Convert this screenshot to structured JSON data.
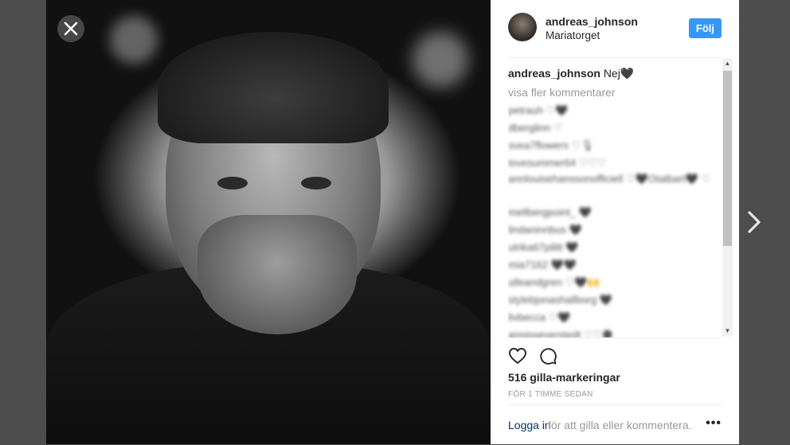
{
  "post": {
    "username": "andreas_johnson",
    "location": "Mariatorget",
    "follow_label": "Följ"
  },
  "caption": {
    "username": "andreas_johnson",
    "text": "Nej🖤"
  },
  "comments": {
    "show_more": "visa fler kommentarer",
    "items": [
      "petrauh ♡🖤",
      "dberglinn ♡",
      "svea7flowers ♡🎙",
      "lovesummer64 ♡♡♡",
      "annlouisehanssonofficiell ♡🖤Otatbart🖤 ♡",
      "mellbergpoint_ 🖤",
      "lindaninnbus 🖤",
      "ulrika67pilitt 🖤",
      "mia7162 🖤🖤",
      "ulleandgren ♡🖤🙌",
      "stylebjonashallborg 🖤",
      "livbecca ♡🖤",
      "annisseverstedt ♡♡🌑"
    ]
  },
  "likes": "516 gilla-markeringar",
  "timestamp": "FÖR 1 TIMME SEDAN",
  "footer": {
    "login_link": "Logga in",
    "login_rest": "för att gilla eller kommentera.",
    "more": "•••"
  },
  "icons": {
    "close": "close-icon",
    "like": "heart-icon",
    "comment": "comment-icon",
    "next": "chevron-right-icon"
  },
  "colors": {
    "follow_button": "#3897f0",
    "overlay": "#4d4d4d",
    "link": "#003569"
  }
}
